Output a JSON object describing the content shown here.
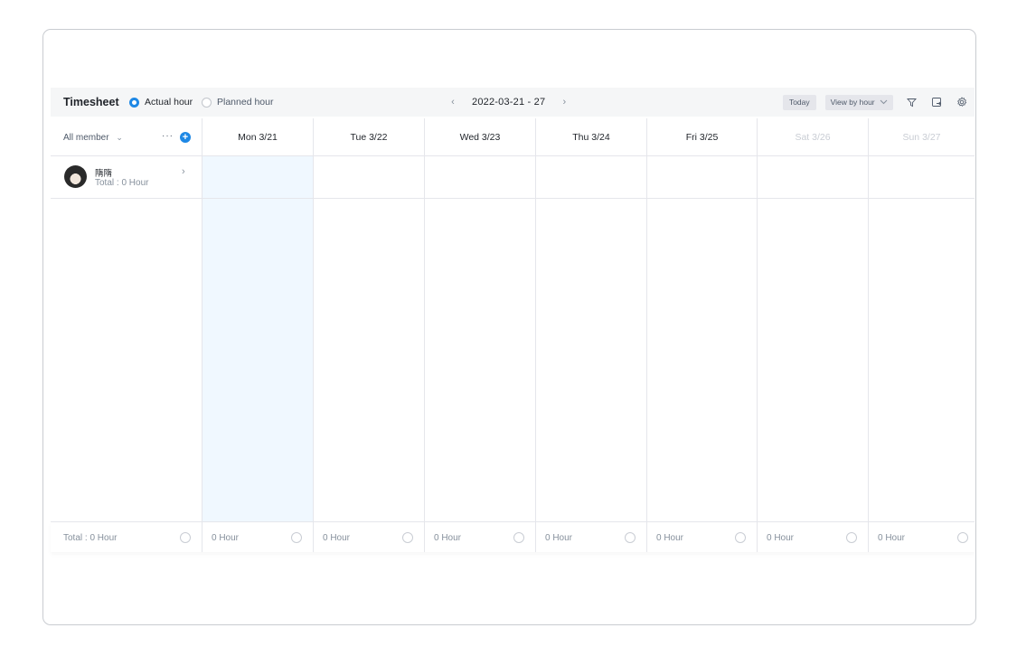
{
  "toolbar": {
    "title": "Timesheet",
    "radio_actual": "Actual hour",
    "radio_planned": "Planned hour",
    "date_range": "2022-03-21 - 27",
    "prev": "‹",
    "next": "›",
    "today": "Today",
    "view_by": "View by hour"
  },
  "members_header": {
    "filter": "All member",
    "more": "···",
    "add": "+"
  },
  "days": [
    {
      "label": "Mon 3/21",
      "weekend": false
    },
    {
      "label": "Tue 3/22",
      "weekend": false
    },
    {
      "label": "Wed 3/23",
      "weekend": false
    },
    {
      "label": "Thu 3/24",
      "weekend": false
    },
    {
      "label": "Fri 3/25",
      "weekend": false
    },
    {
      "label": "Sat 3/26",
      "weekend": true
    },
    {
      "label": "Sun 3/27",
      "weekend": true
    }
  ],
  "member": {
    "name": "隋隋",
    "total": "Total : 0 Hour"
  },
  "footer": {
    "total": "Total : 0 Hour",
    "day_totals": [
      "0 Hour",
      "0 Hour",
      "0 Hour",
      "0 Hour",
      "0 Hour",
      "0 Hour",
      "0 Hour"
    ]
  },
  "colors": {
    "accent": "#1e88e5",
    "highlight_column": "#f0f8ff"
  }
}
